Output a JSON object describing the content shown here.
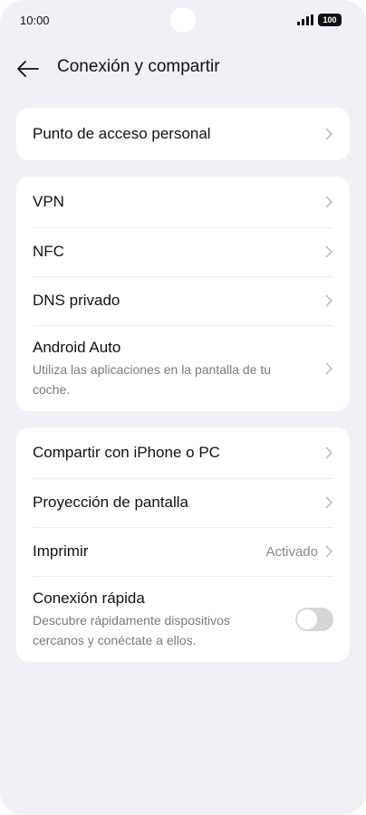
{
  "status_bar": {
    "time": "10:00",
    "battery": "100"
  },
  "header": {
    "title": "Conexión y compartir"
  },
  "groups": [
    {
      "items": [
        {
          "label": "Punto de acceso personal"
        }
      ]
    },
    {
      "items": [
        {
          "label": "VPN"
        },
        {
          "label": "NFC"
        },
        {
          "label": "DNS privado"
        },
        {
          "label": "Android Auto",
          "description": "Utiliza las aplicaciones en la pantalla de tu coche."
        }
      ]
    },
    {
      "items": [
        {
          "label": "Compartir con iPhone o PC"
        },
        {
          "label": "Proyección de pantalla"
        },
        {
          "label": "Imprimir",
          "value": "Activado"
        },
        {
          "label": "Conexión rápida",
          "description": "Descubre rápidamente dispositivos cercanos y conéctate a ellos.",
          "toggle_on": false
        }
      ]
    }
  ]
}
